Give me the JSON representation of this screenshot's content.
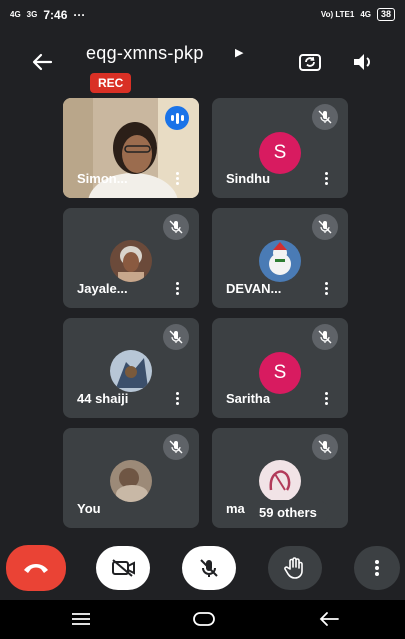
{
  "status_bar": {
    "network_left": "4G",
    "network_left2": "3G",
    "time": "7:46",
    "more": "···",
    "lte": "Vo) LTE1",
    "network_right": "4G",
    "battery": "38"
  },
  "header": {
    "meeting_code": "eqg-xmns-pkp",
    "rec_label": "REC"
  },
  "participants": [
    {
      "name": "Simon...",
      "avatar": "video",
      "state": "speaking"
    },
    {
      "name": "Sindhu",
      "avatar": "letter",
      "letter": "S",
      "state": "muted"
    },
    {
      "name": "Jayale...",
      "avatar": "photo",
      "state": "muted"
    },
    {
      "name": "DEVAN...",
      "avatar": "photo",
      "state": "muted"
    },
    {
      "name": "44 shaiji",
      "avatar": "photo",
      "state": "muted"
    },
    {
      "name": "Saritha",
      "avatar": "letter",
      "letter": "S",
      "state": "muted"
    },
    {
      "name": "You",
      "avatar": "photo",
      "state": "muted"
    },
    {
      "name": "ma",
      "avatar": "photo",
      "state": "muted"
    }
  ],
  "others_chip": "59 others",
  "icons": {
    "back": "arrow-left-icon",
    "switch_camera": "switch-camera-icon",
    "speaker": "speaker-icon",
    "mute": "mic-off-icon",
    "more": "more-vert-icon",
    "end_call": "end-call-icon",
    "camera_off": "camera-off-icon",
    "mic_off": "mic-off-icon",
    "raise_hand": "raise-hand-icon"
  },
  "colors": {
    "background": "#202124",
    "tile": "#3c4043",
    "accent_blue": "#1a73e8",
    "rec_red": "#d93025",
    "end_call_red": "#ea4335",
    "avatar_pink": "#d81b60"
  }
}
